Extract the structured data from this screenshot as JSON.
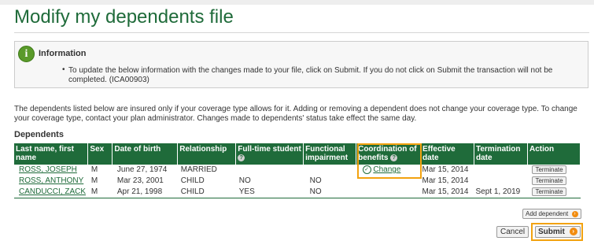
{
  "page": {
    "title": "Modify my dependents file"
  },
  "info": {
    "title": "Information",
    "bullet": "•",
    "text": "To update the below information with the changes made to your file, click on Submit. If you do not click on Submit the transaction will not be completed. (ICA00903)"
  },
  "intro": "The dependents listed below are insured only if your coverage type allows for it. Adding or removing a dependent does not change your coverage type. To change your coverage type, contact your plan administrator. Changes made to dependents' status take effect the same day.",
  "dependents": {
    "section_title": "Dependents",
    "columns": [
      "Last name, first name",
      "Sex",
      "Date of birth",
      "Relationship",
      "Full-time student",
      "Functional impairment",
      "Coordination of benefits",
      "Effective date",
      "Termination date",
      "Action"
    ],
    "help_icon": "?",
    "change_label": "Change",
    "terminate_label": "Terminate",
    "rows": [
      {
        "name": "ROSS, JOSEPH",
        "sex": "M",
        "dob": "June 27, 1974",
        "relationship": "MARRIED",
        "student": "",
        "impairment": "",
        "effective": "Mar 15, 2014",
        "termination": ""
      },
      {
        "name": "ROSS, ANTHONY",
        "sex": "M",
        "dob": "Mar 23, 2001",
        "relationship": "CHILD",
        "student": "NO",
        "impairment": "NO",
        "effective": "Mar 15, 2014",
        "termination": ""
      },
      {
        "name": "CANDUCCI, ZACK",
        "sex": "M",
        "dob": "Apr 21, 1998",
        "relationship": "CHILD",
        "student": "YES",
        "impairment": "NO",
        "effective": "Mar 15, 2014",
        "termination": "Sept 1, 2019"
      }
    ]
  },
  "actions": {
    "add_dependent": "Add dependent",
    "cancel": "Cancel",
    "submit": "Submit"
  },
  "colors": {
    "brand_green": "#1f6b3a",
    "highlight_orange": "#f2a20f",
    "accent_orange": "#f28c0f"
  }
}
